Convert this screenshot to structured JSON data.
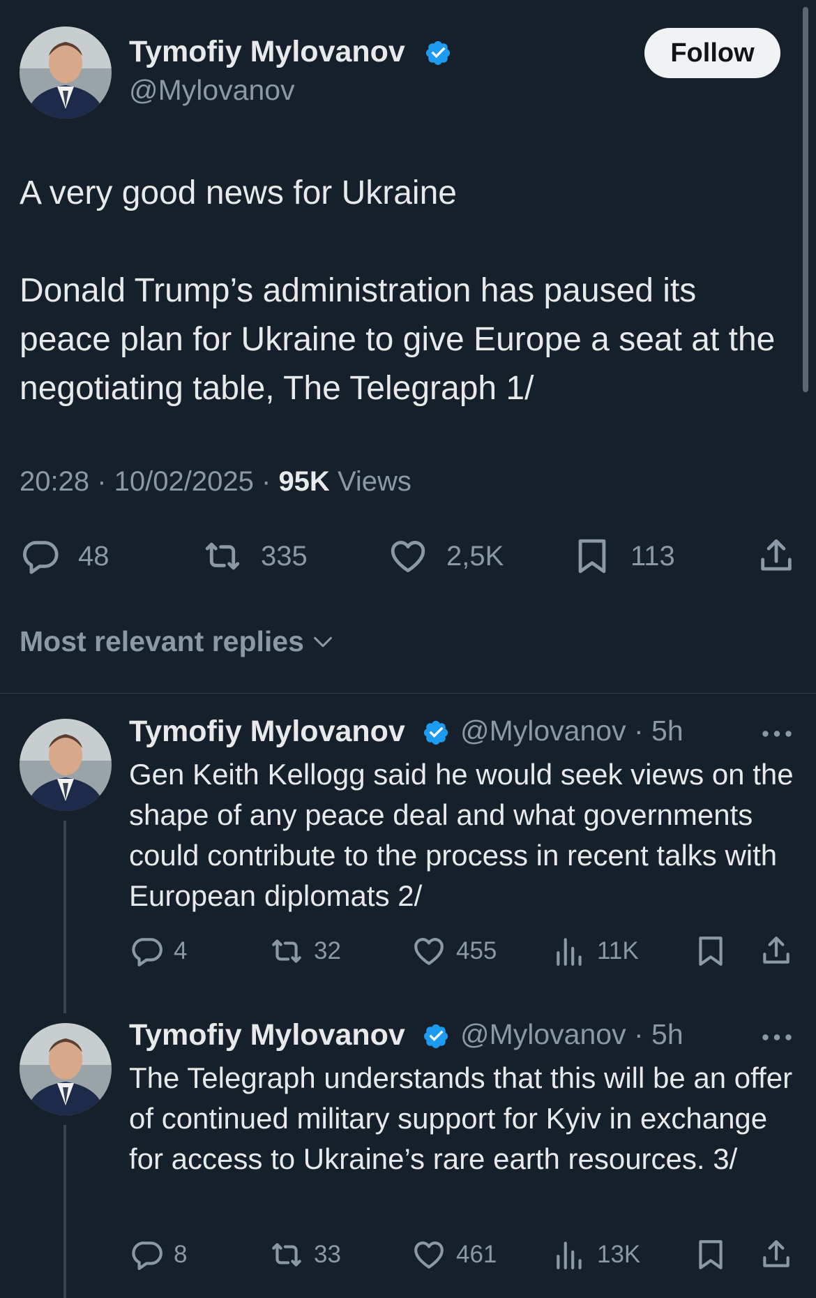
{
  "colors": {
    "background": "#15202b",
    "verified": "#1d9bf0",
    "muted": "#8b98a5",
    "text": "#e7e9ea"
  },
  "main_tweet": {
    "author_name": "Tymofiy Mylovanov",
    "handle": "@Mylovanov",
    "follow_label": "Follow",
    "paragraph_1": "A very good news for Ukraine",
    "paragraph_2": "Donald Trump’s administration has paused its peace plan for Ukraine to give Europe a seat at the negotiating table, The Telegraph 1/",
    "time": "20:28",
    "date": "10/02/2025",
    "views_count": "95K",
    "views_label": "Views",
    "stats": {
      "replies": "48",
      "reposts": "335",
      "likes": "2,5K",
      "bookmarks": "113"
    }
  },
  "replies_filter": {
    "label": "Most relevant replies",
    "icon": "chevron-down-icon"
  },
  "replies": [
    {
      "author_name": "Tymofiy Mylovanov",
      "handle_time": "@Mylovanov · 5h",
      "text": "Gen Keith Kellogg said he would seek views on the shape of any peace deal and what governments could contribute to the process in recent talks with European diplomats 2/",
      "stats": {
        "replies": "4",
        "reposts": "32",
        "likes": "455",
        "views": "11K"
      }
    },
    {
      "author_name": "Tymofiy Mylovanov",
      "handle_time": "@Mylovanov · 5h",
      "text": "The Telegraph understands that this will be an offer of continued military support for Kyiv in exchange for access to Ukraine’s rare earth resources. 3/",
      "stats": {
        "replies": "8",
        "reposts": "33",
        "likes": "461",
        "views": "13K"
      }
    }
  ]
}
